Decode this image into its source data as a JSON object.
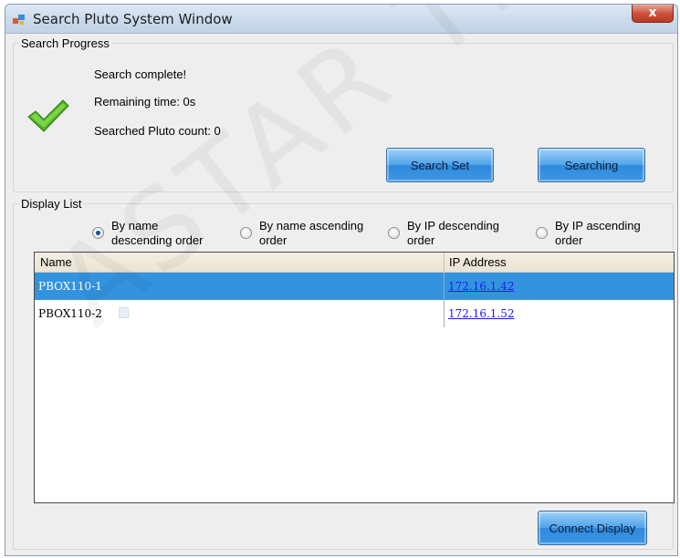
{
  "window": {
    "title": "Search Pluto System Window",
    "close_label": "x"
  },
  "progress": {
    "legend": "Search Progress",
    "status": "Search complete!",
    "remaining": "Remaining time: 0s",
    "count": "Searched Pluto count: 0",
    "search_set_label": "Search Set",
    "searching_label": "Searching"
  },
  "display": {
    "legend": "Display List",
    "sort_options": [
      {
        "label": "By name descending order",
        "checked": true
      },
      {
        "label": "By name ascending order",
        "checked": false
      },
      {
        "label": "By IP descending order",
        "checked": false
      },
      {
        "label": "By IP ascending order",
        "checked": false
      }
    ],
    "columns": [
      "Name",
      "IP Address"
    ],
    "rows": [
      {
        "name": "PBOX110-1",
        "ip": "172.16.1.42",
        "selected": true
      },
      {
        "name": "PBOX110-2",
        "ip": "172.16.1.52",
        "selected": false
      }
    ],
    "connect_label": "Connect Display"
  },
  "watermark": "ASTAR TECH",
  "colors": {
    "selection": "#3393df",
    "button": "#4fa3ea",
    "check": "#4cb320",
    "link": "#1a1aff"
  }
}
